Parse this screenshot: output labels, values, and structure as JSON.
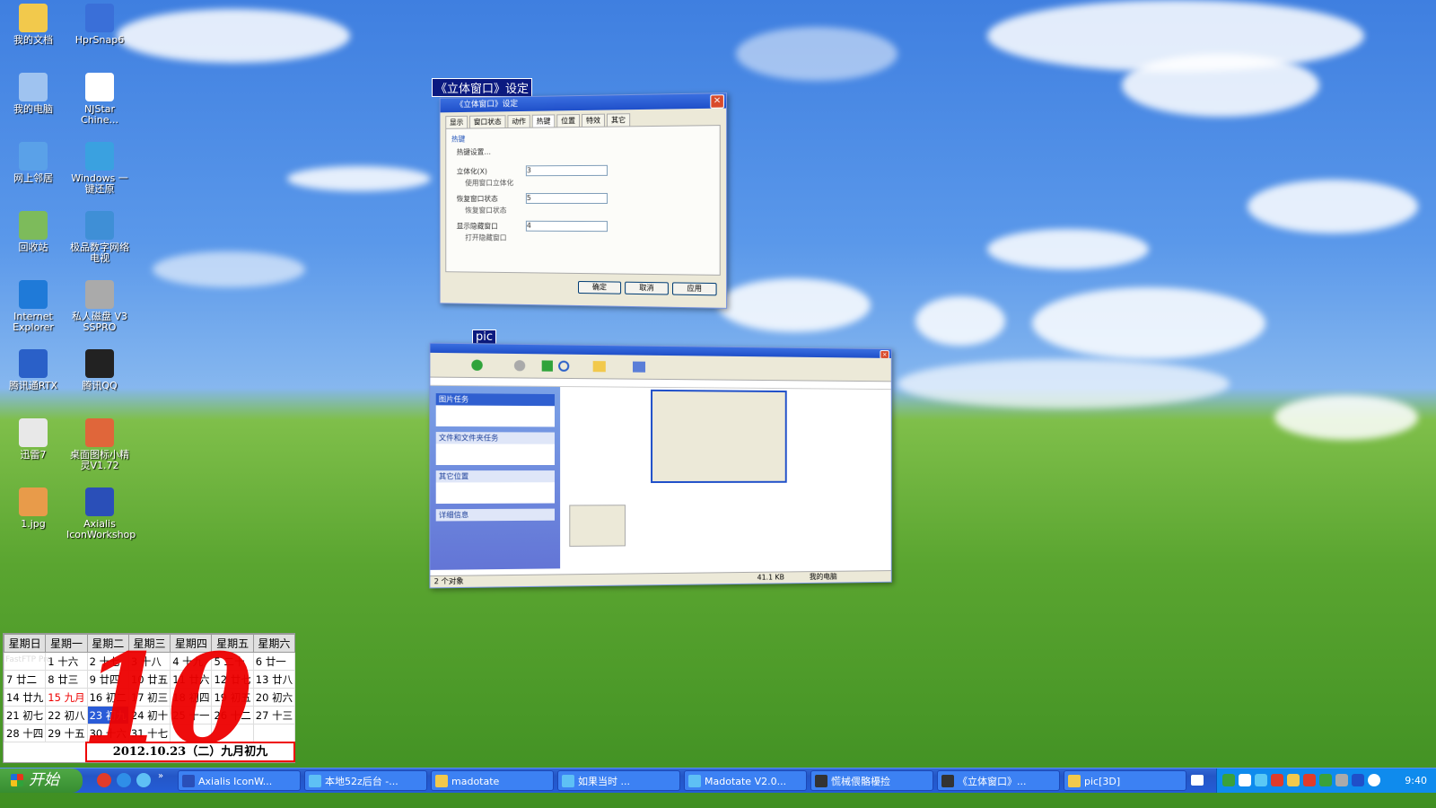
{
  "desktop_icons": [
    {
      "label": "我的文档",
      "icon": "folder-icon",
      "color": "#f2c94c"
    },
    {
      "label": "HprSnap6",
      "icon": "camera-icon",
      "color": "#3a6fd8"
    },
    {
      "label": "我的电脑",
      "icon": "computer-icon",
      "color": "#9fc3f0"
    },
    {
      "label": "NJStar Chine...",
      "icon": "nj-icon",
      "color": "#ffffff"
    },
    {
      "label": "网上邻居",
      "icon": "network-icon",
      "color": "#5aa1e8"
    },
    {
      "label": "Windows 一键还原",
      "icon": "restore-icon",
      "color": "#3aa1e0"
    },
    {
      "label": "回收站",
      "icon": "recycle-bin-icon",
      "color": "#7dbb5b"
    },
    {
      "label": "极品数字网络电视",
      "icon": "tv-icon",
      "color": "#3f8fd6"
    },
    {
      "label": "Internet Explorer",
      "icon": "ie-icon",
      "color": "#1f7ad8"
    },
    {
      "label": "私人磁盘 V3 SSPRO",
      "icon": "disk-icon",
      "color": "#aaaaaa"
    },
    {
      "label": "腾讯通RTX",
      "icon": "rtx-icon",
      "color": "#2a60c8"
    },
    {
      "label": "腾讯QQ",
      "icon": "qq-icon",
      "color": "#222222"
    },
    {
      "label": "迅雷7",
      "icon": "thunder-icon",
      "color": "#e8e8e8"
    },
    {
      "label": "桌面图标小精灵V1.72",
      "icon": "sprite-icon",
      "color": "#e0663a"
    },
    {
      "label": "1.jpg",
      "icon": "jpg-icon",
      "color": "#e89b4a"
    },
    {
      "label": "Axialis IconWorkshop",
      "icon": "axialis-icon",
      "color": "#2a4fb8"
    }
  ],
  "window_settings": {
    "caption": "《立体窗口》设定",
    "title": "《立体窗口》设定",
    "tabs": [
      "显示",
      "窗口状态",
      "动作",
      "热键",
      "位置",
      "特效",
      "其它"
    ],
    "panel_title": "热键",
    "description": "热键设置…",
    "fields": [
      {
        "label": "立体化(X)",
        "value": "3",
        "hint": "使用窗口立体化"
      },
      {
        "label": "恢复窗口状态",
        "value": "5",
        "hint": "恢复窗口状态"
      },
      {
        "label": "显示隐藏窗口",
        "value": "4",
        "hint": "打开隐藏窗口"
      }
    ],
    "buttons": [
      "确定",
      "取消",
      "应用"
    ]
  },
  "window_pic": {
    "caption": "pic",
    "status_left": "2 个对象",
    "status_mid": "41.1 KB",
    "status_right": "我的电脑",
    "sidebar_sections": [
      "图片任务",
      "文件和文件夹任务",
      "其它位置",
      "详细信息"
    ]
  },
  "calendar": {
    "headers": [
      "星期日",
      "星期一",
      "星期二",
      "星期三",
      "星期四",
      "星期五",
      "星期六"
    ],
    "rows": [
      [
        "",
        "1 十六",
        "2 十七",
        "3 十八",
        "4 十九",
        "5 二十",
        "6 廿一"
      ],
      [
        "7 廿二",
        "8 廿三",
        "9 廿四",
        "10 廿五",
        "11 廿六",
        "12 廿七",
        "13 廿八"
      ],
      [
        "14 廿九",
        "15 九月",
        "16 初二",
        "17 初三",
        "18 初四",
        "19 初五",
        "20 初六"
      ],
      [
        "21 初七",
        "22 初八",
        "23 初九",
        "24 初十",
        "25 十一",
        "26 十二",
        "27 十三"
      ],
      [
        "28 十四",
        "29 十五",
        "30 十六",
        "31 十七",
        "",
        "",
        ""
      ]
    ],
    "big_month": "10",
    "date_line": "2012.10.23（二）九月初九",
    "overlay_label": "FastFTP Pro"
  },
  "taskbar": {
    "start_label": "开始",
    "items": [
      {
        "label": "Axialis IconW...",
        "icon": "axialis-icon"
      },
      {
        "label": "本地52z后台 -...",
        "icon": "ie-icon"
      },
      {
        "label": "madotate",
        "icon": "folder-icon"
      },
      {
        "label": "如果当时 ...",
        "icon": "ie-icon"
      },
      {
        "label": "Madotate V2.0...",
        "icon": "ie-icon"
      },
      {
        "label": "慌械偎骼櫌捡",
        "icon": "app-icon"
      },
      {
        "label": "《立体窗口》...",
        "icon": "app-icon"
      },
      {
        "label": "pic[3D]",
        "icon": "folder-icon"
      }
    ],
    "clock": "9:40"
  }
}
